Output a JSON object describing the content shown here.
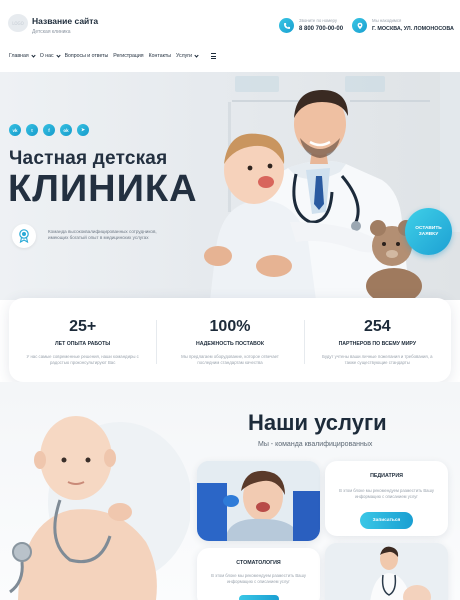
{
  "header": {
    "logo_text": "LOGO",
    "site_title": "Название сайта",
    "site_subtitle": "Детская клиника",
    "phone_label": "Звоните по номеру",
    "phone": "8 800 700-00-00",
    "address_label": "Мы находимся",
    "address": "Г. МОСКВА, УЛ. ЛОМОНОСОВА"
  },
  "nav": {
    "items": [
      "Главная",
      "О нас",
      "Вопросы и ответы",
      "Регистрация",
      "Контакты",
      "Услуги"
    ]
  },
  "hero": {
    "socials": [
      "vk",
      "tw",
      "fb",
      "ok",
      "tg"
    ],
    "title_line1": "Частная детская",
    "title_line2": "КЛИНИКА",
    "description": "Команда высококвалифицированных сотрудников, имеющих богатый опыт в медицинских услугах",
    "order_button": "ОСТАВИТЬ ЗАЯВКУ"
  },
  "stats": [
    {
      "value": "25+",
      "label": "ЛЕТ ОПЫТА РАБОТЫ",
      "text": "У нас самые современные решения, наши командиры с радостью проконсультируют Вас"
    },
    {
      "value": "100%",
      "label": "НАДЕЖНОСТЬ ПОСТАВОК",
      "text": "Мы предлагаем оборудование, которое отвечает последним стандартам качества"
    },
    {
      "value": "254",
      "label": "ПАРТНЕРОВ ПО ВСЕМУ МИРУ",
      "text": "Будут учтены ваши личные пожелания и требования, а также существующие стандарты"
    }
  ],
  "services": {
    "title": "Наши услуги",
    "subtitle": "Мы - команда квалифицированных",
    "cards": [
      {
        "title": "ПЕДИАТРИЯ",
        "text": "В этом блоке мы рекомендуем разместить Вашу информацию с описанием услуг",
        "button": "Записаться"
      },
      {
        "title": "СТОМАТОЛОГИЯ",
        "text": "В этом блоке мы рекомендуем разместить Вашу информацию с описанием услуг"
      }
    ]
  },
  "colors": {
    "accent": "#1da0d3",
    "accent_light": "#3fd0e8",
    "text_dark": "#1d2b3a"
  }
}
